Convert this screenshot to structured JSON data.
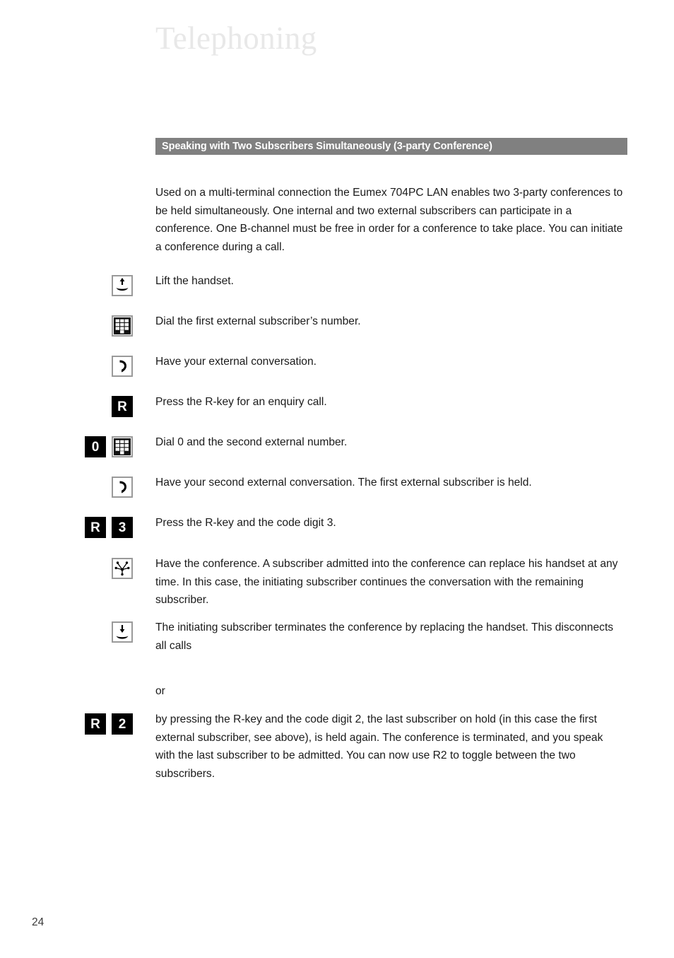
{
  "page": {
    "title": "Telephoning",
    "number": "24"
  },
  "section": {
    "heading": "Speaking with Two Subscribers Simultaneously (3-party Conference)",
    "heading_bg": "#808080",
    "heading_fg": "#ffffff",
    "intro": "Used on a multi-terminal connection the Eumex 704PC LAN enables two 3-party conferences to be held simultaneously. One internal and two external subscribers can participate in a conference. One B-channel must be free in order for a conference to take place. You can initiate a conference during a call."
  },
  "steps": [
    {
      "icons": [
        {
          "type": "framed",
          "name": "lift-handset-icon"
        }
      ],
      "text": "Lift the handset."
    },
    {
      "icons": [
        {
          "type": "framed",
          "name": "keypad-icon"
        }
      ],
      "text": "Dial the first external subscriber’s number."
    },
    {
      "icons": [
        {
          "type": "framed",
          "name": "handset-conversation-icon"
        }
      ],
      "text": "Have your external conversation."
    },
    {
      "icons": [
        {
          "type": "key",
          "name": "r-key",
          "label": "R"
        }
      ],
      "text": "Press the R-key for an enquiry call."
    },
    {
      "icons": [
        {
          "type": "key",
          "name": "zero-key",
          "label": "0"
        },
        {
          "type": "framed",
          "name": "keypad-icon"
        }
      ],
      "text": "Dial 0 and the second external number."
    },
    {
      "icons": [
        {
          "type": "framed",
          "name": "handset-conversation-icon"
        }
      ],
      "text": "Have your second external conversation. The first external subscriber is held."
    },
    {
      "icons": [
        {
          "type": "key",
          "name": "r-key",
          "label": "R"
        },
        {
          "type": "key",
          "name": "digit-3-key",
          "label": "3"
        }
      ],
      "text": "Press the R-key and the code digit 3."
    },
    {
      "icons": [
        {
          "type": "framed",
          "name": "conference-icon"
        }
      ],
      "text": "Have the conference. A subscriber admitted into the conference can replace his handset at any time. In this case, the initiating subscriber continues the conversation with the remaining subscriber."
    },
    {
      "icons": [
        {
          "type": "framed",
          "name": "replace-handset-icon"
        }
      ],
      "text": "The initiating subscriber terminates the conference by replacing the handset. This disconnects all calls"
    },
    {
      "icons": [],
      "text": "or"
    },
    {
      "icons": [
        {
          "type": "key",
          "name": "r-key",
          "label": "R"
        },
        {
          "type": "key",
          "name": "digit-2-key",
          "label": "2"
        }
      ],
      "text": "by pressing the R-key and the code digit 2, the last subscriber on hold (in this case the first external subscriber, see above), is held again. The conference is terminated, and you speak with the last subscriber to be admitted. You can now use R2 to toggle between the two subscribers."
    }
  ]
}
